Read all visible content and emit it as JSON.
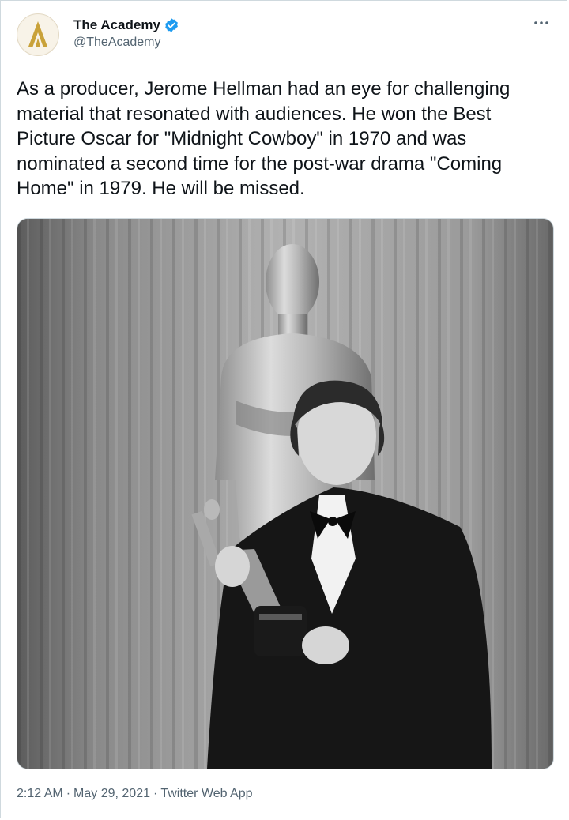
{
  "author": {
    "display_name": "The Academy",
    "handle": "@TheAcademy",
    "verified": true,
    "avatar_icon": "academy-logo-icon",
    "brand_color": "#c9a23a"
  },
  "more_icon": "more-horizontal-icon",
  "tweet": {
    "text": "As a producer, Jerome Hellman had an eye for challenging material that resonated with audiences. He won the Best Picture Oscar for \"Midnight Cowboy\" in 1970 and was nominated a second time for the post-war drama \"Coming Home\" in 1979. He will be missed.",
    "time": "2:12 AM",
    "date": "May 29, 2021",
    "source": "Twitter Web App",
    "separator": "·"
  },
  "colors": {
    "text_primary": "#0f1419",
    "text_secondary": "#536471",
    "verified_blue": "#1d9bf0",
    "border": "#cfd9de"
  }
}
